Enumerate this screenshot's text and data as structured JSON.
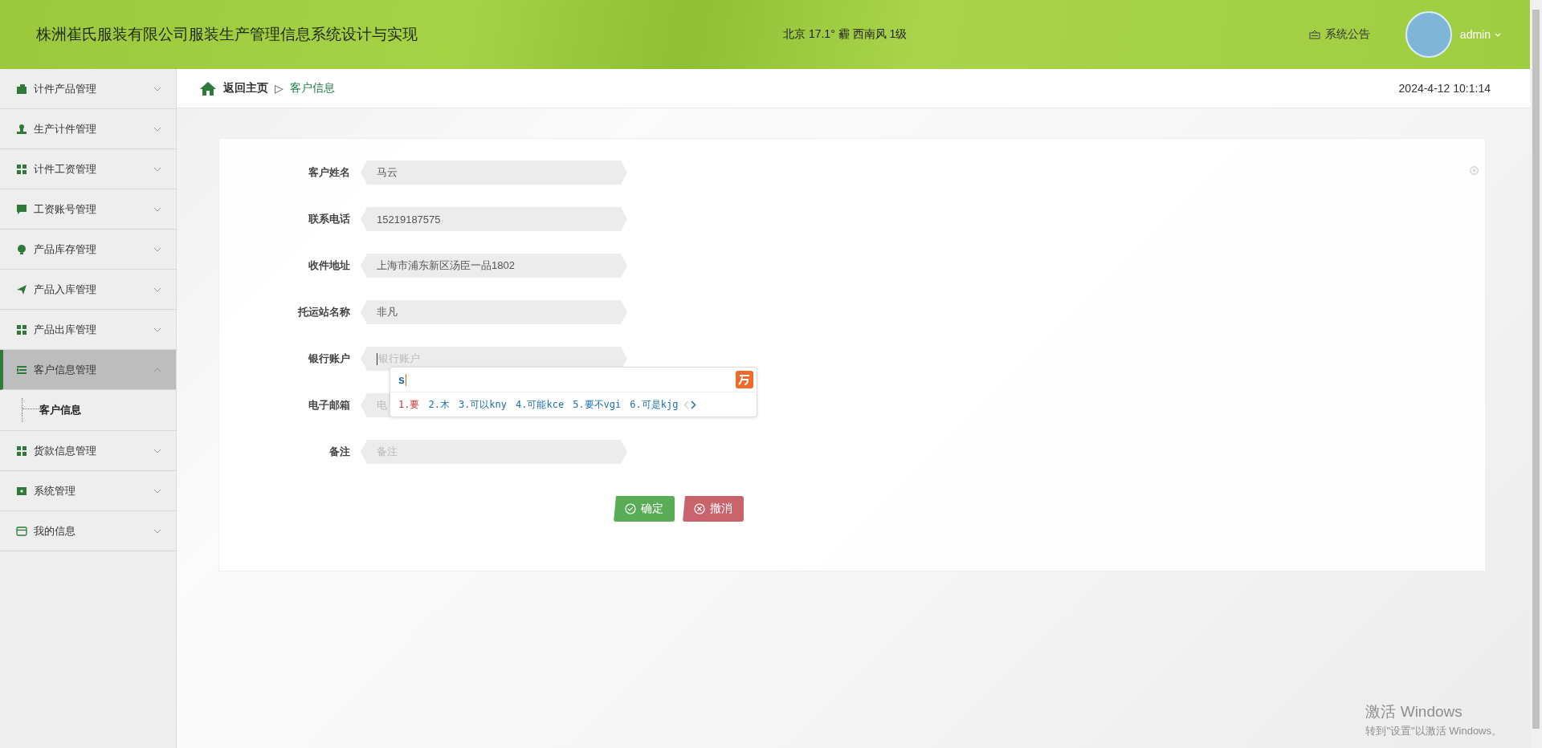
{
  "header": {
    "title": "株洲崔氏服装有限公司服装生产管理信息系统设计与实现",
    "weather": "北京  17.1°  霾  西南风  1级",
    "notice": "系统公告",
    "user": "admin"
  },
  "sidebar": {
    "items": [
      {
        "label": "计件产品管理",
        "expanded": false,
        "selected": false
      },
      {
        "label": "生产计件管理",
        "expanded": false,
        "selected": false
      },
      {
        "label": "计件工资管理",
        "expanded": false,
        "selected": false
      },
      {
        "label": "工资账号管理",
        "expanded": false,
        "selected": false
      },
      {
        "label": "产品库存管理",
        "expanded": false,
        "selected": false
      },
      {
        "label": "产品入库管理",
        "expanded": false,
        "selected": false
      },
      {
        "label": "产品出库管理",
        "expanded": false,
        "selected": false
      },
      {
        "label": "客户信息管理",
        "expanded": true,
        "selected": true,
        "children": [
          {
            "label": "客户信息",
            "selected": true
          }
        ]
      },
      {
        "label": "货款信息管理",
        "expanded": false,
        "selected": false
      },
      {
        "label": "系统管理",
        "expanded": false,
        "selected": false
      },
      {
        "label": "我的信息",
        "expanded": false,
        "selected": false
      }
    ]
  },
  "breadcrumb": {
    "home": "返回主页",
    "separator": "▷",
    "current": "客户信息",
    "datetime": "2024-4-12 10:1:14"
  },
  "form": {
    "fields": [
      {
        "label": "客户姓名",
        "value": "马云",
        "focused": false
      },
      {
        "label": "联系电话",
        "value": "15219187575",
        "focused": false
      },
      {
        "label": "收件地址",
        "value": "上海市浦东新区汤臣一品1802",
        "focused": false
      },
      {
        "label": "托运站名称",
        "value": "非凡",
        "focused": false
      },
      {
        "label": "银行账户",
        "placeholder": "银行账户",
        "focused": true
      },
      {
        "label": "电子邮箱",
        "placeholder": "电",
        "focused": false
      },
      {
        "label": "备注",
        "placeholder": "备注",
        "focused": false
      }
    ],
    "buttons": [
      {
        "label": "确定",
        "kind": "confirm"
      },
      {
        "label": "撤消",
        "kind": "cancel"
      }
    ]
  },
  "ime": {
    "input": "s",
    "candidates": [
      {
        "text": "1.要",
        "selected": true
      },
      {
        "text": "2.木",
        "selected": false
      },
      {
        "text": "3.可以kny",
        "selected": false
      },
      {
        "text": "4.可能kce",
        "selected": false
      },
      {
        "text": "5.要不vgi",
        "selected": false
      },
      {
        "text": "6.可是kjg",
        "selected": false
      }
    ]
  },
  "os_overlay": {
    "title": "激活 Windows",
    "subtitle": "转到\"设置\"以激活 Windows。"
  }
}
